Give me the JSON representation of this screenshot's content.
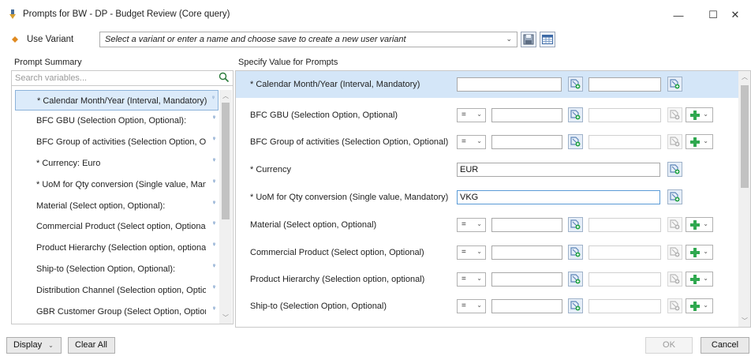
{
  "window": {
    "title": "Prompts for BW - DP - Budget Review (Core query)",
    "min_glyph": "—",
    "max_glyph": "☐",
    "close_glyph": "✕"
  },
  "variant": {
    "label": "Use Variant",
    "placeholder": "Select a variant or enter a name and choose save to create a new user variant",
    "chevron": "⌄"
  },
  "left": {
    "header": "Prompt Summary",
    "search_placeholder": "Search variables...",
    "flag_glyph": "ᵠ",
    "items": [
      {
        "label": "* Calendar Month/Year (Interval, Mandatory):",
        "selected": true
      },
      {
        "label": "BFC GBU (Selection Option, Optional):"
      },
      {
        "label": "BFC Group of activities (Selection Option, Op"
      },
      {
        "label": "* Currency: Euro"
      },
      {
        "label": "* UoM for Qty conversion (Single value, Manc"
      },
      {
        "label": "Material (Select option, Optional):"
      },
      {
        "label": "Commercial Product (Select option, Optional)"
      },
      {
        "label": "Product Hierarchy (Selection option, optional"
      },
      {
        "label": "Ship-to (Selection Option, Optional):"
      },
      {
        "label": "Distribution Channel (Selection option, Optio"
      },
      {
        "label": "GBR Customer Group (Select Option, Optiona"
      }
    ]
  },
  "right": {
    "header": "Specify Value for Prompts",
    "op_symbol": "=",
    "op_chevron": "⌄",
    "prompts": [
      {
        "label": "* Calendar Month/Year (Interval, Mandatory)",
        "kind": "interval",
        "value_from": "",
        "value_to": ""
      },
      {
        "label": "BFC GBU (Selection Option, Optional)",
        "kind": "selopt",
        "value_from": "",
        "value_to": ""
      },
      {
        "label": "BFC Group of activities (Selection Option, Optional)",
        "kind": "selopt",
        "value_from": "",
        "value_to": ""
      },
      {
        "label": "* Currency",
        "kind": "single",
        "value": "EUR"
      },
      {
        "label": "* UoM for Qty conversion (Single value, Mandatory)",
        "kind": "single",
        "value": "VKG"
      },
      {
        "label": "Material (Select option, Optional)",
        "kind": "selopt",
        "value_from": "",
        "value_to": ""
      },
      {
        "label": "Commercial Product (Select option, Optional)",
        "kind": "selopt",
        "value_from": "",
        "value_to": ""
      },
      {
        "label": "Product Hierarchy (Selection option, optional)",
        "kind": "selopt",
        "value_from": "",
        "value_to": ""
      },
      {
        "label": "Ship-to (Selection Option, Optional)",
        "kind": "selopt",
        "value_from": "",
        "value_to": ""
      }
    ]
  },
  "footer": {
    "display_label": "Display",
    "display_chevron": "⌄",
    "clear_label": "Clear All",
    "ok_label": "OK",
    "cancel_label": "Cancel"
  },
  "colors": {
    "selection_bg": "#dcebfa",
    "selected_row_bg": "#d4e6f8",
    "plus_green": "#2fa84f",
    "accent_blue": "#3a6fb0"
  }
}
